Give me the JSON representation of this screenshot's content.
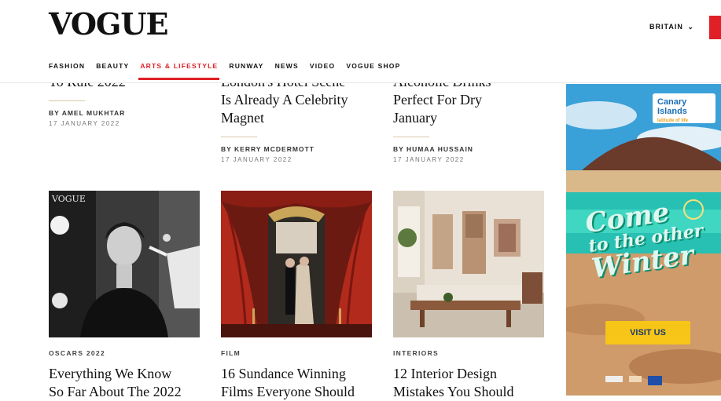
{
  "header": {
    "logo": "VOGUE",
    "region": "BRITAIN",
    "nav": [
      "FASHION",
      "BEAUTY",
      "ARTS & LIFESTYLE",
      "RUNWAY",
      "NEWS",
      "VIDEO",
      "VOGUE SHOP"
    ],
    "active_nav": "ARTS & LIFESTYLE"
  },
  "top_row": [
    {
      "title_lines": [
        "To Rule 2022"
      ],
      "byline": "BY AMEL MUKHTAR",
      "date": "17 JANUARY 2022"
    },
    {
      "title_lines": [
        "London's Hotel Scene",
        "Is Already A Celebrity",
        "Magnet"
      ],
      "byline": "BY KERRY MCDERMOTT",
      "date": "17 JANUARY 2022"
    },
    {
      "title_lines": [
        "Alcoholic Drinks",
        "Perfect For Dry",
        "January"
      ],
      "byline": "BY HUMAA HUSSAIN",
      "date": "17 JANUARY 2022"
    }
  ],
  "cards": [
    {
      "kicker": "OSCARS 2022",
      "title_lines": [
        "Everything We Know",
        "So Far About The 2022"
      ]
    },
    {
      "kicker": "FILM",
      "title_lines": [
        "16 Sundance Winning",
        "Films Everyone Should"
      ]
    },
    {
      "kicker": "INTERIORS",
      "title_lines": [
        "12 Interior Design",
        "Mistakes You Should"
      ]
    }
  ],
  "card1_image_logo": "VOGUE",
  "ad": {
    "brand_line1": "Canary",
    "brand_line2": "Islands",
    "brand_tagline": "latitude of life",
    "headline_1": "Come",
    "headline_2": "to the other",
    "headline_3": "Winter",
    "button": "VISIT US"
  },
  "colors": {
    "accent": "#e01f26",
    "ad_button": "#f6c518"
  }
}
